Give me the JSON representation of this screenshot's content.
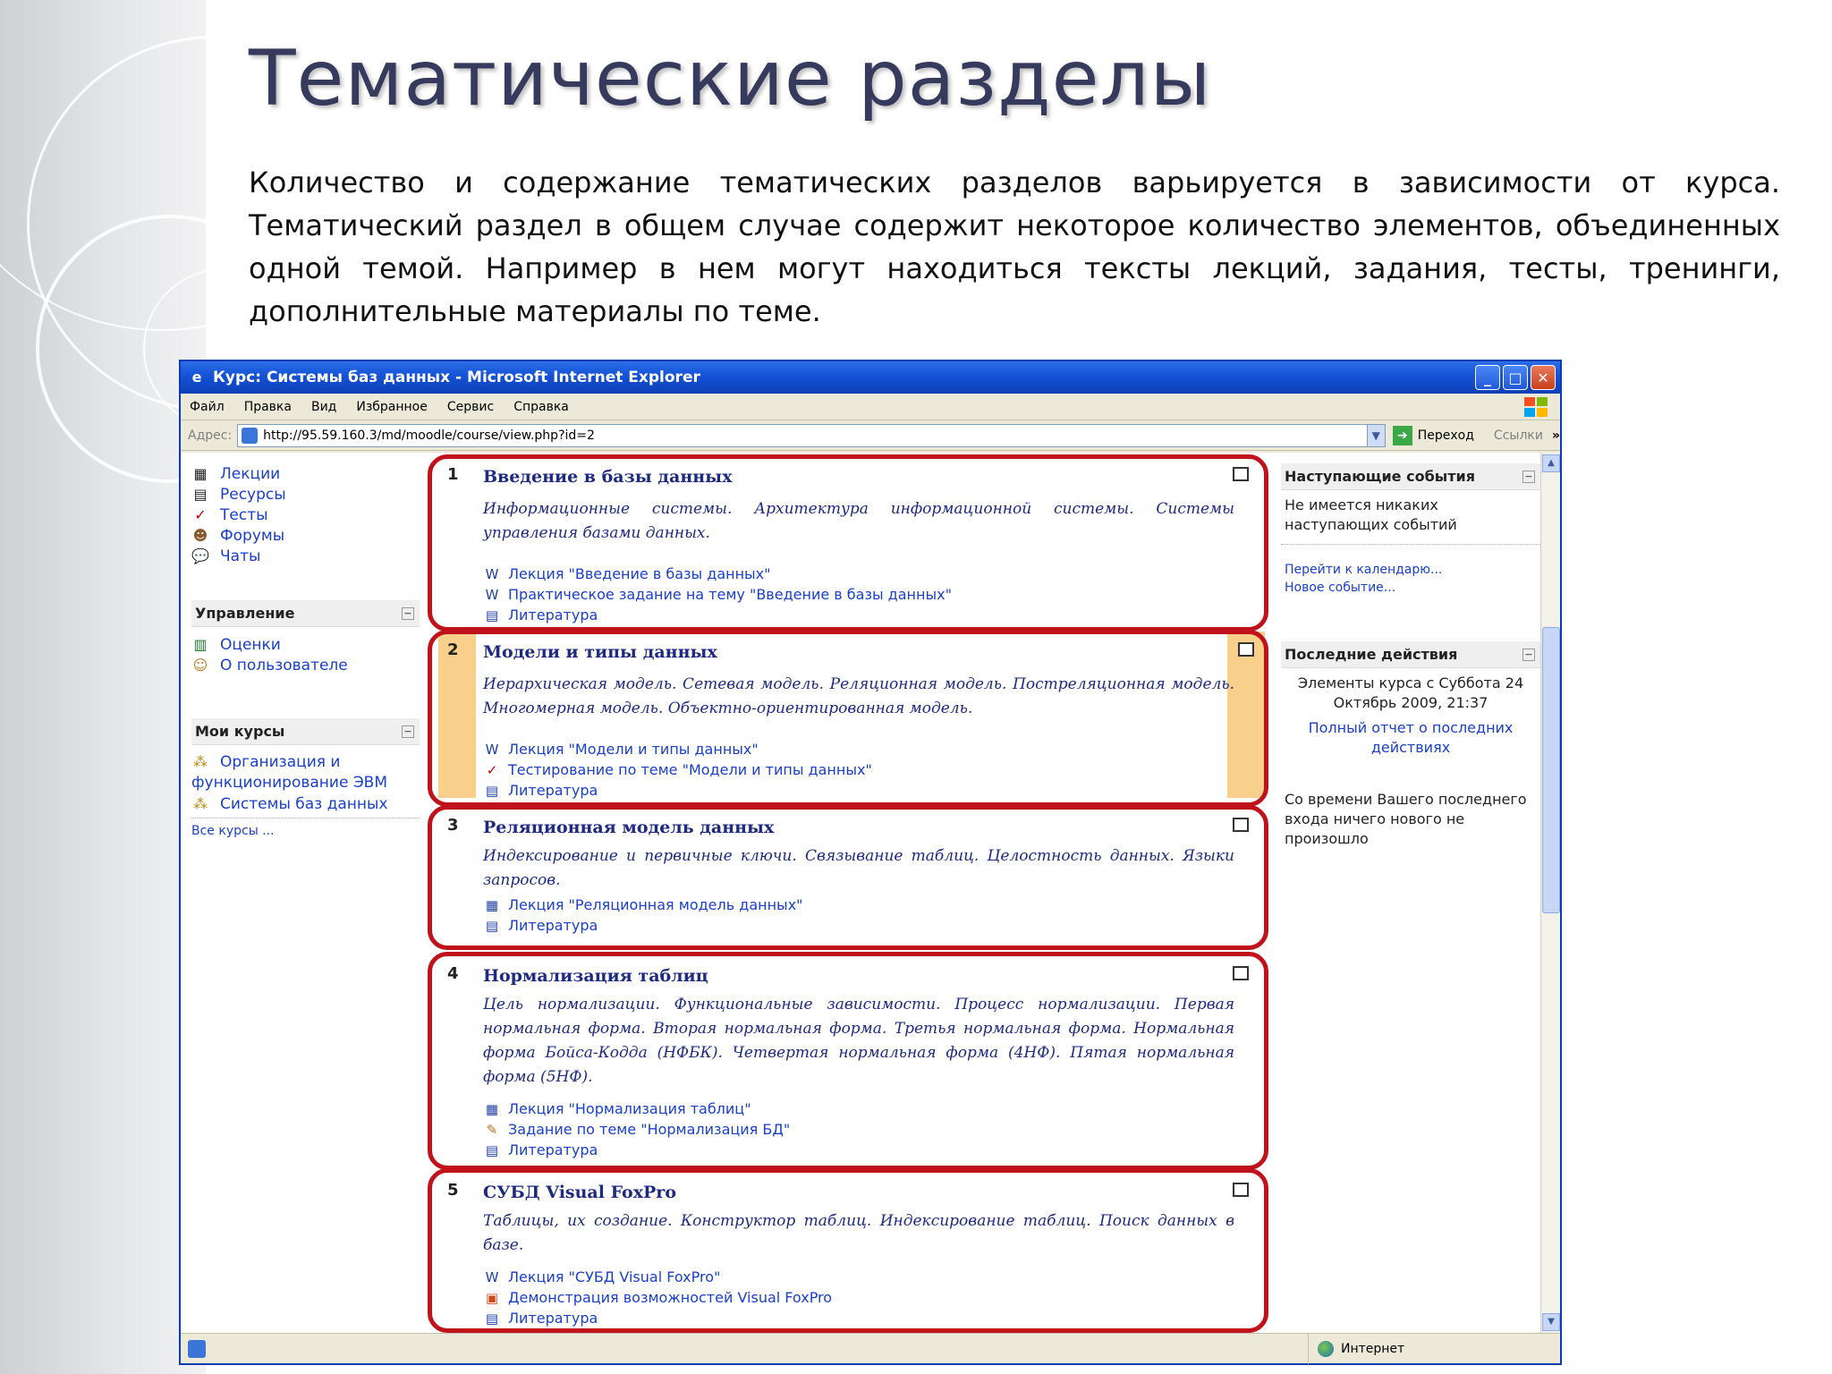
{
  "slide": {
    "title": "Тематические разделы",
    "paragraph": "Количество и содержание тематических разделов варьируется в зависимости от курса. Тематический раздел в общем случае содержит некоторое количество элементов, объединенных одной темой. Например в нем могут находиться тексты лекций, задания, тесты, тренинги, дополнительные материалы по теме."
  },
  "window": {
    "title": "Курс: Системы баз данных - Microsoft Internet Explorer",
    "menu": [
      "Файл",
      "Правка",
      "Вид",
      "Избранное",
      "Сервис",
      "Справка"
    ],
    "address_label": "Адрес:",
    "url": "http://95.59.160.3/md/moodle/course/view.php?id=2",
    "go_label": "Переход",
    "links_label": "Ссылки",
    "status_zone": "Интернет"
  },
  "left_column": {
    "activities": [
      {
        "label": "Лекции",
        "icon": "lecture-icon"
      },
      {
        "label": "Ресурсы",
        "icon": "resource-icon"
      },
      {
        "label": "Тесты",
        "icon": "quiz-icon"
      },
      {
        "label": "Форумы",
        "icon": "forum-icon"
      },
      {
        "label": "Чаты",
        "icon": "chat-icon"
      }
    ],
    "admin_title": "Управление",
    "admin_items": [
      {
        "label": "Оценки",
        "icon": "grades-icon"
      },
      {
        "label": "О пользователе",
        "icon": "profile-icon"
      }
    ],
    "mycourses_title": "Мои курсы",
    "mycourses": [
      {
        "label": "Организация и функционирование ЭВМ",
        "icon": "course-icon"
      },
      {
        "label": "Системы баз данных",
        "icon": "course-icon"
      }
    ],
    "all_courses": "Все курсы ..."
  },
  "sections": [
    {
      "num": "1",
      "title": "Введение в базы данных",
      "desc": "Информационные системы. Архитектура информационной системы. Системы управления базами данных.",
      "items": [
        {
          "label": "Лекция \"Введение в базы данных\"",
          "icon": "word-doc-icon"
        },
        {
          "label": "Практическое задание на тему \"Введение в базы данных\"",
          "icon": "word-doc-icon"
        },
        {
          "label": "Литература",
          "icon": "text-doc-icon"
        }
      ]
    },
    {
      "num": "2",
      "title": "Модели и типы данных",
      "desc": "Иерархическая модель. Сетевая модель. Реляционная модель. Постреляционная модель. Многомерная модель. Объектно-ориентированная модель.",
      "items": [
        {
          "label": "Лекция \"Модели и типы данных\"",
          "icon": "word-doc-icon"
        },
        {
          "label": "Тестирование по теме \"Модели и типы данных\"",
          "icon": "quiz-icon"
        },
        {
          "label": "Литература",
          "icon": "text-doc-icon"
        }
      ]
    },
    {
      "num": "3",
      "title": "Реляционная модель данных",
      "desc": "Индексирование и первичные ключи. Связывание таблиц. Целостность данных. Языки запросов.",
      "items": [
        {
          "label": "Лекция \"Реляционная модель данных\"",
          "icon": "lecture-icon"
        },
        {
          "label": "Литература",
          "icon": "text-doc-icon"
        }
      ]
    },
    {
      "num": "4",
      "title": "Нормализация таблиц",
      "desc": "Цель нормализации. Функциональные зависимости. Процесс нормализации. Первая нормальная форма. Вторая нормальная форма. Третья нормальная форма. Нормальная форма Бойса-Кодда (НФБК). Четвертая нормальная форма (4НФ). Пятая нормальная форма (5НФ).",
      "items": [
        {
          "label": "Лекция \"Нормализация таблиц\"",
          "icon": "lecture-icon"
        },
        {
          "label": "Задание по теме \"Нормализация БД\"",
          "icon": "assignment-icon"
        },
        {
          "label": "Литература",
          "icon": "text-doc-icon"
        }
      ]
    },
    {
      "num": "5",
      "title": "СУБД Visual FoxPro",
      "desc": "Таблицы, их создание. Конструктор таблиц. Индексирование таблиц. Поиск данных в базе.",
      "items": [
        {
          "label": "Лекция \"СУБД Visual FoxPro\"",
          "icon": "word-doc-icon"
        },
        {
          "label": "Демонстрация возможностей Visual FoxPro",
          "icon": "presentation-icon"
        },
        {
          "label": "Литература",
          "icon": "text-doc-icon"
        }
      ]
    }
  ],
  "right_column": {
    "events_title": "Наступающие события",
    "events_empty": "Не имеется никаких наступающих событий",
    "go_calendar": "Перейти к календарю...",
    "new_event": "Новое событие...",
    "recent_title": "Последние действия",
    "recent_since": "Элементы курса с Суббота 24 Октябрь 2009, 21:37",
    "full_report": "Полный отчет о последних действиях",
    "nothing_new": "Со времени Вашего последнего входа ничего нового не произошло"
  },
  "colors": {
    "frame_red": "#c0121a",
    "highlight_orange": "#f8cf8b",
    "link_blue": "#1a3fc8",
    "title_navy": "#363a5c"
  }
}
